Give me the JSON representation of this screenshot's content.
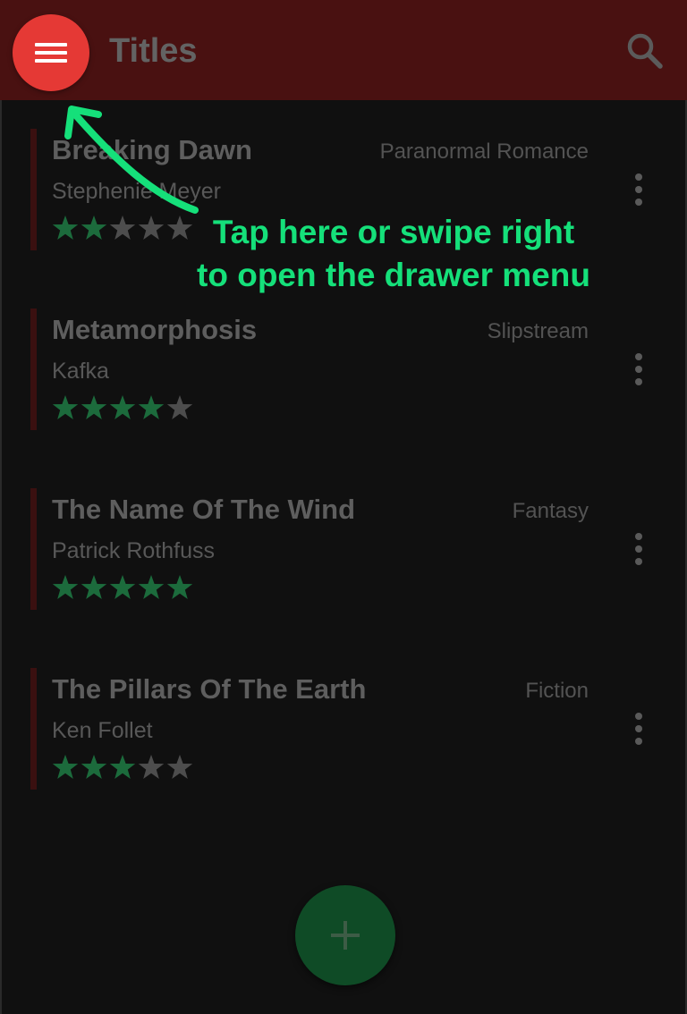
{
  "app_bar": {
    "title": "Titles",
    "menu_icon": "hamburger-menu-icon",
    "search_icon": "search-icon"
  },
  "colors": {
    "app_bar": "#491111",
    "menu_button": "#e53935",
    "star_filled": "#1c6b3c",
    "star_empty": "#4d4d4d",
    "fab": "#0f4b26",
    "hint": "#15e07a"
  },
  "books": [
    {
      "title": "Breaking Dawn",
      "author": "Stephenie Meyer",
      "genre": "Paranormal Romance",
      "rating": 2,
      "max_rating": 5
    },
    {
      "title": "Metamorphosis",
      "author": "Kafka",
      "genre": "Slipstream",
      "rating": 4,
      "max_rating": 5
    },
    {
      "title": "The Name Of The Wind",
      "author": "Patrick Rothfuss",
      "genre": "Fantasy",
      "rating": 5,
      "max_rating": 5
    },
    {
      "title": "The Pillars Of The Earth",
      "author": "Ken Follet",
      "genre": "Fiction",
      "rating": 3,
      "max_rating": 5
    }
  ],
  "row_actions": {
    "more_icon": "more-vertical-icon"
  },
  "fab": {
    "icon": "plus-icon"
  },
  "hint": {
    "line1": "Tap here or swipe right",
    "line2": "to open the drawer menu"
  }
}
